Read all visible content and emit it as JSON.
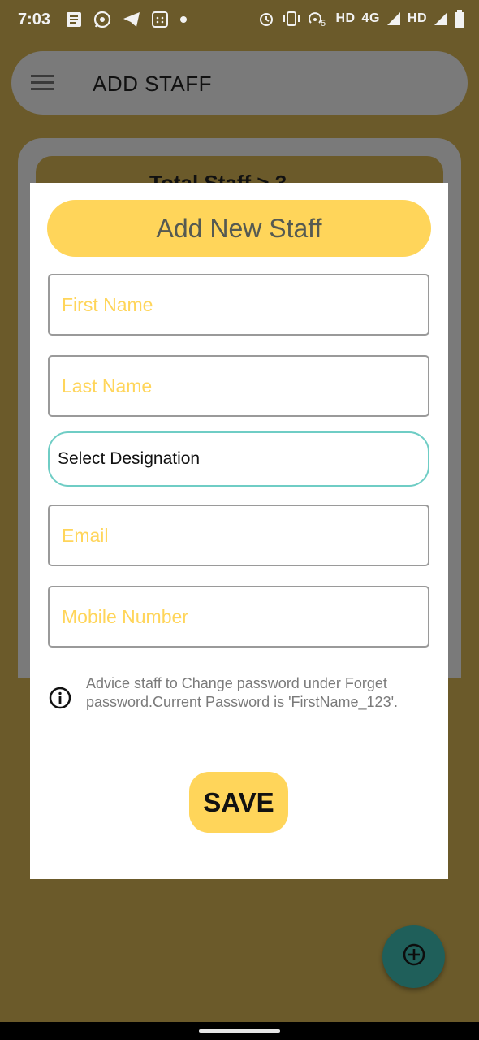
{
  "status_bar": {
    "time": "7:03",
    "left_icons": [
      "news-icon",
      "whatsapp-icon",
      "telegram-icon",
      "calculator-icon",
      "dot-icon"
    ],
    "right_text_1": "HD",
    "right_text_2": "4G",
    "right_text_3": "HD",
    "right_icons": [
      "alarm-icon",
      "vibrate-icon",
      "hotspot-icon",
      "signal-icon",
      "signal-icon",
      "battery-icon"
    ],
    "hotspot_badge": "5"
  },
  "app_bar": {
    "title": "ADD STAFF",
    "menu_icon": "hamburger-menu-icon"
  },
  "background": {
    "total_staff_text": "Total Staff  >  3"
  },
  "dialog": {
    "title": "Add New Staff",
    "fields": {
      "first_name_placeholder": "First Name",
      "last_name_placeholder": "Last Name",
      "designation_value": "Select Designation",
      "email_placeholder": "Email",
      "mobile_placeholder": "Mobile Number"
    },
    "info_icon": "info-icon",
    "info_text": "Advice staff to Change password under Forget password.Current Password is 'FirstName_123'.",
    "save_label": "SAVE"
  },
  "fab": {
    "icon": "add-circle-icon"
  },
  "colors": {
    "accent_yellow": "#ffd55a",
    "dim_background": "#6b5a2a",
    "select_border_teal": "#6fcdc5",
    "fab_teal": "#1f5f5a"
  }
}
